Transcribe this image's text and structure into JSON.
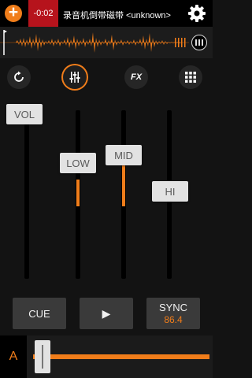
{
  "topbar": {
    "add_label": "+",
    "time_elapsed": "-0:02",
    "track_title": "录音机倒带磁带 <unknown>"
  },
  "icons": {
    "add": "add-icon",
    "settings": "gear-icon",
    "grid_small": "grid-icon",
    "sync": "sync-icon",
    "eq": "equalizer-icon",
    "fx": "FX",
    "pads": "pads-grid-icon",
    "play": "play-icon"
  },
  "toolbar": {
    "fx_label": "FX",
    "active_tool": "equalizer"
  },
  "mixer": {
    "vol": {
      "label": "VOL",
      "level": 1.0
    },
    "low": {
      "label": "LOW",
      "level": 0.5
    },
    "mid": {
      "label": "MID",
      "level": 0.5
    },
    "hi": {
      "label": "HI",
      "level": 0.5
    }
  },
  "transport": {
    "cue_label": "CUE",
    "play_glyph": "▶",
    "sync_label": "SYNC",
    "bpm": "86.4"
  },
  "deck": {
    "label": "A",
    "crossfader_position": 0.0
  },
  "colors": {
    "accent": "#f07d1a",
    "time_badge": "#b6131c",
    "background": "#131313"
  }
}
